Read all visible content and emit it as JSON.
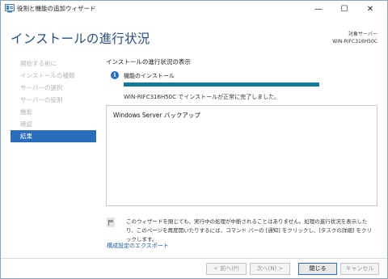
{
  "window": {
    "title": "役割と機能の追加ウィザード",
    "minimize_glyph": "—",
    "maximize_glyph": "☐",
    "close_glyph": "✕"
  },
  "header": {
    "page_title": "インストールの進行状況",
    "server_label": "対象サーバー",
    "server_name": "WIN-RIFC316H50C"
  },
  "nav": {
    "items": [
      {
        "label": "開始する前に",
        "active": false
      },
      {
        "label": "インストールの種類",
        "active": false
      },
      {
        "label": "サーバーの選択",
        "active": false
      },
      {
        "label": "サーバーの役割",
        "active": false
      },
      {
        "label": "機能",
        "active": false
      },
      {
        "label": "確認",
        "active": false
      },
      {
        "label": "結果",
        "active": true
      }
    ]
  },
  "content": {
    "section_title": "インストールの進行状況の表示",
    "info_icon_glyph": "i",
    "feature_label": "機能のインストール",
    "progress_percent": 100,
    "status_text": "WIN-RIFC316H50C でインストールが正常に完了しました。",
    "results": [
      "Windows Server バックアップ"
    ],
    "note": "このウィザードを閉じても、実行中の処理が中断されることはありません。処理の進行状況を表示したり、このページを再度開いたりするには、コマンド バーの [通知] をクリックし、[タスクの詳細] をクリックします。",
    "export_link": "構成設定のエクスポート"
  },
  "buttons": {
    "back": "< 前へ(P)",
    "next": "次へ(N) >",
    "close": "閉じる",
    "cancel": "キャンセル"
  },
  "colors": {
    "accent": "#2a6ebb",
    "title": "#2a4f79",
    "progress": "#137a9a"
  }
}
